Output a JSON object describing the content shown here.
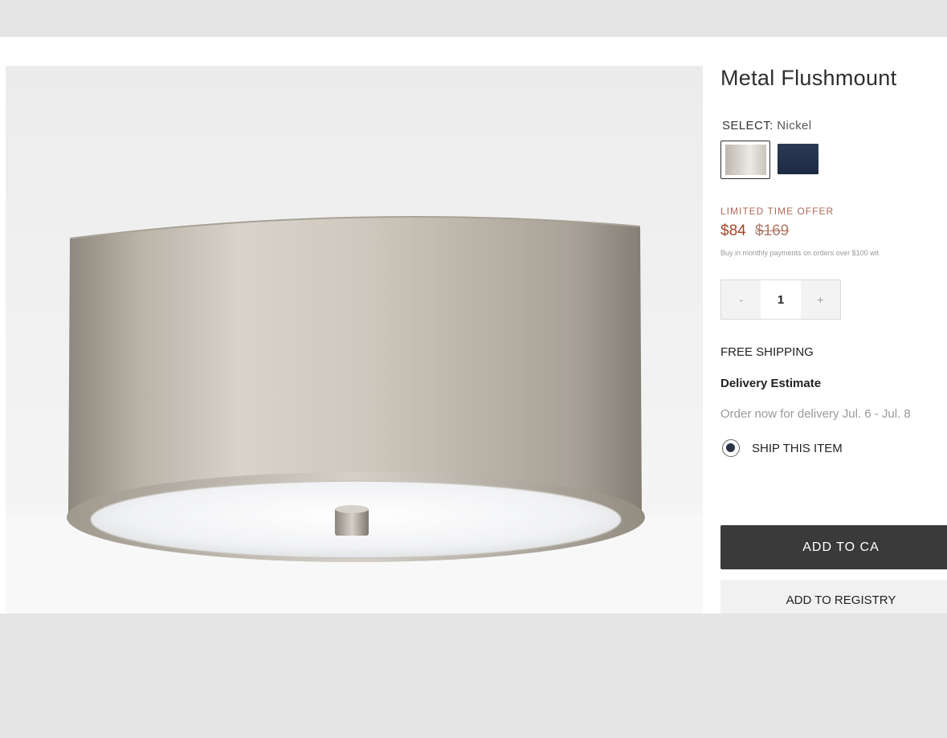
{
  "product": {
    "title": "Metal Flushmount",
    "image_alt": "Metal Flushmount ceiling light in nickel finish"
  },
  "selection": {
    "key": "SELECT:",
    "value": "Nickel",
    "swatches": [
      {
        "name": "Nickel",
        "selected": true
      },
      {
        "name": "Navy",
        "selected": false
      }
    ]
  },
  "pricing": {
    "offer_label": "LIMITED TIME OFFER",
    "sale_price": "$84",
    "original_price": "$169",
    "installments_text": "Buy in monthly payments on orders over $100 wit"
  },
  "quantity": {
    "decrement": "-",
    "value": "1",
    "increment": "+"
  },
  "shipping": {
    "free_label": "FREE SHIPPING",
    "delivery_title": "Delivery Estimate",
    "delivery_text": "Order now for delivery Jul. 6 - Jul. 8",
    "ship_option_label": "SHIP THIS ITEM"
  },
  "actions": {
    "add_to_cart": "ADD TO CA",
    "add_to_registry": "ADD TO REGISTRY"
  },
  "colors": {
    "sale_price": "#a84426",
    "primary_button": "#3a3a3a",
    "navy_swatch": "#1d2a43"
  }
}
